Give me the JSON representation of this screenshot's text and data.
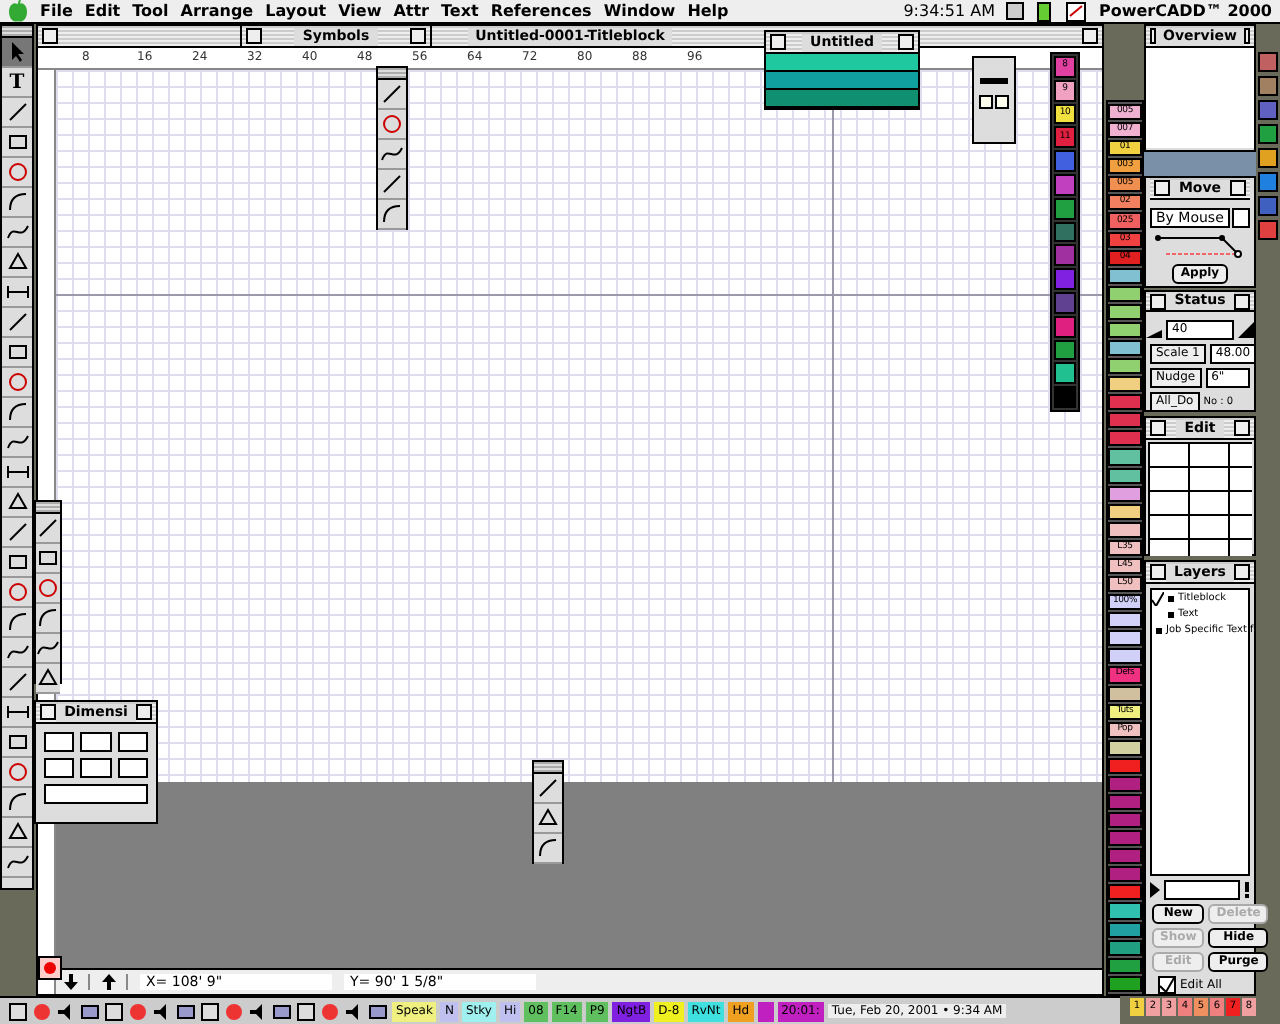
{
  "menu_bar": {
    "menus": [
      "File",
      "Edit",
      "Tool",
      "Arrange",
      "Layout",
      "View",
      "Attr",
      "Text",
      "References",
      "Window",
      "Help"
    ],
    "clock": "9:34:51 AM",
    "app": "PowerCADD™ 2000"
  },
  "document": {
    "title": "Untitled-0001-Titleblock",
    "ruler_labels": [
      "8",
      "16",
      "24",
      "32",
      "40",
      "48",
      "56",
      "64",
      "72",
      "80",
      "88",
      "96"
    ],
    "x_reading": "X= 108' 9\"",
    "y_reading": "Y= 90' 1 5/8\""
  },
  "tools": [
    {
      "kind": "arrow",
      "selected": true
    },
    {
      "kind": "glyph",
      "glyph": "T",
      "selected": false
    },
    {
      "kind": "line",
      "selected": false
    },
    {
      "kind": "rect",
      "selected": false
    },
    {
      "kind": "circle",
      "selected": false
    },
    {
      "kind": "arc",
      "selected": false
    },
    {
      "kind": "curve",
      "selected": false
    },
    {
      "kind": "polygon",
      "selected": false
    },
    {
      "kind": "dimension",
      "selected": false
    },
    {
      "kind": "line",
      "selected": false
    },
    {
      "kind": "rect",
      "selected": false
    },
    {
      "kind": "circle",
      "selected": false
    },
    {
      "kind": "arc",
      "selected": false
    },
    {
      "kind": "curve",
      "selected": false
    },
    {
      "kind": "dimension",
      "selected": false
    },
    {
      "kind": "polygon",
      "selected": false
    },
    {
      "kind": "line",
      "selected": false
    },
    {
      "kind": "rect",
      "selected": false
    },
    {
      "kind": "circle",
      "selected": false
    },
    {
      "kind": "arc",
      "selected": false
    },
    {
      "kind": "curve",
      "selected": false
    },
    {
      "kind": "line",
      "selected": false
    },
    {
      "kind": "dimension",
      "selected": false
    },
    {
      "kind": "rect",
      "selected": false
    },
    {
      "kind": "circle",
      "selected": false
    },
    {
      "kind": "arc",
      "selected": false
    },
    {
      "kind": "polygon",
      "selected": false
    },
    {
      "kind": "curve",
      "selected": false
    }
  ],
  "tools_extra": [
    {
      "kind": "line",
      "selected": false
    },
    {
      "kind": "rect",
      "selected": false
    },
    {
      "kind": "circle",
      "selected": false
    },
    {
      "kind": "arc",
      "selected": false
    },
    {
      "kind": "curve",
      "selected": false
    },
    {
      "kind": "polygon",
      "selected": false
    }
  ],
  "symbols_palette": {
    "title": "Symbols"
  },
  "symbol_tools": [
    {
      "kind": "line",
      "selected": false
    },
    {
      "kind": "circle",
      "selected": false
    },
    {
      "kind": "curve",
      "selected": false
    },
    {
      "kind": "line",
      "selected": false
    },
    {
      "kind": "arc",
      "selected": false
    }
  ],
  "bottom_tools": [
    {
      "kind": "line",
      "selected": false
    },
    {
      "kind": "polygon",
      "selected": false
    },
    {
      "kind": "arc",
      "selected": false
    }
  ],
  "layer_list_palette": {
    "title": "Untitled",
    "rows": [
      {
        "color": "#20c8a0"
      },
      {
        "color": "#10a0a0"
      },
      {
        "color": "#109070"
      }
    ]
  },
  "dimension_palette": {
    "title": "Dimensi"
  },
  "color_tabs": [
    {
      "label": "8",
      "color": "#e040a0"
    },
    {
      "label": "9",
      "color": "#f0a0c0"
    },
    {
      "label": "10",
      "color": "#f0e040"
    },
    {
      "label": "11",
      "color": "#e02040"
    },
    {
      "color": "#4060e0"
    },
    {
      "color": "#c040c0"
    },
    {
      "color": "#20a040"
    },
    {
      "color": "#307060"
    },
    {
      "color": "#a030a0"
    },
    {
      "color": "#8020e0"
    },
    {
      "color": "#604090"
    },
    {
      "color": "#e02080"
    },
    {
      "color": "#20a040"
    },
    {
      "color": "#20c090"
    },
    {
      "color": "#000000"
    }
  ],
  "style_tabs": [
    {
      "label": "005",
      "color": "#f0b0d0"
    },
    {
      "label": "007",
      "color": "#f0b0d0"
    },
    {
      "label": "01",
      "color": "#f0d040"
    },
    {
      "label": "003",
      "color": "#f0a040"
    },
    {
      "label": "005",
      "color": "#f09050"
    },
    {
      "label": "02",
      "color": "#f08060"
    },
    {
      "label": "025",
      "color": "#f06060"
    },
    {
      "label": "03",
      "color": "#f04040"
    },
    {
      "label": "04",
      "color": "#e02020"
    },
    {
      "color": "#80c0d0"
    },
    {
      "color": "#90d070"
    },
    {
      "color": "#90d070"
    },
    {
      "color": "#90d070"
    },
    {
      "color": "#80c0d0"
    },
    {
      "color": "#90d070"
    },
    {
      "color": "#f0d080"
    },
    {
      "color": "#e03050"
    },
    {
      "color": "#e03050"
    },
    {
      "color": "#e03050"
    },
    {
      "color": "#60c0a0"
    },
    {
      "color": "#60c0a0"
    },
    {
      "color": "#e0a0e0"
    },
    {
      "color": "#f0d080"
    },
    {
      "color": "#f0c0c0"
    },
    {
      "label": "L35",
      "color": "#f0c0c0"
    },
    {
      "label": "L45",
      "color": "#f0c0c0"
    },
    {
      "label": "L50",
      "color": "#f0c0c0"
    },
    {
      "label": "100%",
      "color": "#d0d0f8"
    },
    {
      "color": "#d0d0f8"
    },
    {
      "color": "#d0d0f8"
    },
    {
      "color": "#d0d0f8"
    },
    {
      "label": "Defs",
      "color": "#f03080"
    },
    {
      "color": "#d0c0a0"
    },
    {
      "label": "Tuts",
      "color": "#f0f080"
    },
    {
      "label": "Pop",
      "color": "#f0c0c0"
    },
    {
      "color": "#d0d0a0"
    },
    {
      "color": "#f02020"
    },
    {
      "color": "#b02080"
    },
    {
      "color": "#b02080"
    },
    {
      "color": "#b02080"
    },
    {
      "color": "#b02080"
    },
    {
      "color": "#b02080"
    },
    {
      "color": "#b02080"
    },
    {
      "color": "#f02020"
    },
    {
      "color": "#30c0b0"
    },
    {
      "color": "#20a0a0"
    },
    {
      "color": "#20a080"
    },
    {
      "color": "#20a040"
    },
    {
      "color": "#20a020"
    }
  ],
  "overview": {
    "title": "Overview"
  },
  "move": {
    "title": "Move",
    "mode": "By Mouse",
    "apply": "Apply"
  },
  "status": {
    "title": "Status",
    "zoom": "40",
    "scale_label": "Scale 1",
    "scale_value": "48.00",
    "nudge_label": "Nudge",
    "nudge_value": "6\"",
    "all_button": "All_Do",
    "count": "No : 0"
  },
  "edit": {
    "title": "Edit"
  },
  "layers": {
    "title": "Layers",
    "items": [
      {
        "name": "Titleblock",
        "active": true
      },
      {
        "name": "Text",
        "active": false
      },
      {
        "name": "Job Specific Text f",
        "active": false
      }
    ],
    "buttons": [
      {
        "label": "New",
        "disabled": false
      },
      {
        "label": "Delete",
        "disabled": true
      },
      {
        "label": "Show",
        "disabled": true
      },
      {
        "label": "Hide",
        "disabled": false
      },
      {
        "label": "Edit",
        "disabled": true
      },
      {
        "label": "Purge",
        "disabled": false
      }
    ],
    "edit_all": {
      "label": "Edit All",
      "checked": true
    }
  },
  "app_icons": [
    {
      "color": "#c06060"
    },
    {
      "color": "#a08060"
    },
    {
      "color": "#6060c0"
    },
    {
      "color": "#20a040"
    },
    {
      "color": "#e0a020"
    },
    {
      "color": "#2080e0"
    },
    {
      "color": "#4060c0"
    },
    {
      "color": "#e04040"
    }
  ],
  "color_chips": [
    {
      "label": "1",
      "color": "#f0d040"
    },
    {
      "label": "2",
      "color": "#f0a0a0"
    },
    {
      "label": "3",
      "color": "#f0a0a0"
    },
    {
      "label": "4",
      "color": "#f08080"
    },
    {
      "label": "5",
      "color": "#f09060"
    },
    {
      "label": "6",
      "color": "#f08080"
    },
    {
      "label": "7",
      "color": "#f02020"
    },
    {
      "label": "8",
      "color": "#f0a0a0"
    }
  ],
  "control_strip": {
    "items": [
      {
        "label": "Speak",
        "color": "#f0f080"
      },
      {
        "label": "N",
        "color": "#c0c0f0"
      },
      {
        "label": "Stky",
        "color": "#a0f0f0"
      },
      {
        "label": "Hi",
        "color": "#c0c0f0"
      },
      {
        "label": "08",
        "color": "#60c060"
      },
      {
        "label": "F14",
        "color": "#60c060"
      },
      {
        "label": "P9",
        "color": "#60c060"
      },
      {
        "label": "NgtB",
        "color": "#8020e0"
      },
      {
        "label": "D-8",
        "color": "#f0f020"
      },
      {
        "label": "RvNt",
        "color": "#40e0e0"
      },
      {
        "label": "Hd",
        "color": "#f0a020"
      },
      {
        "color": "#c020c0"
      },
      {
        "label": "20:01:",
        "color": "#c020c0"
      }
    ],
    "date": "Tue, Feb 20, 2001 • 9:34 AM"
  }
}
